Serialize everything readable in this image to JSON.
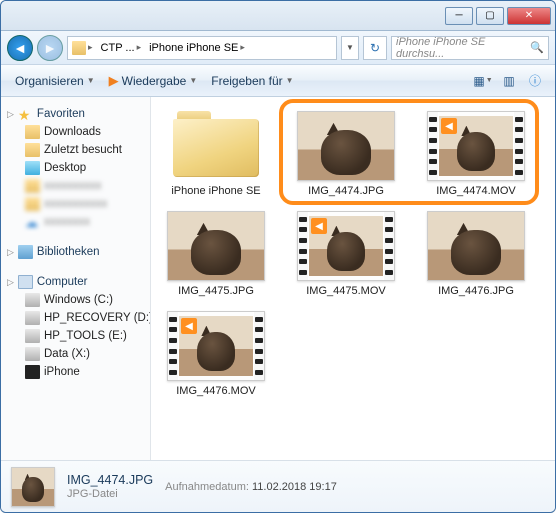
{
  "breadcrumb": {
    "seg1": "CTP ...",
    "seg2": "iPhone iPhone SE"
  },
  "search": {
    "placeholder": "iPhone iPhone SE durchsu..."
  },
  "toolbar": {
    "organize": "Organisieren",
    "playback": "Wiedergabe",
    "share": "Freigeben für"
  },
  "sidebar": {
    "favorites": "Favoriten",
    "downloads": "Downloads",
    "recent": "Zuletzt besucht",
    "desktop": "Desktop",
    "b1": "xxxxxxxxxx",
    "b2": "xxxxxxxxxxx",
    "b3": "xxxxxxxx",
    "libraries": "Bibliotheken",
    "computer": "Computer",
    "d1": "Windows (C:)",
    "d2": "HP_RECOVERY (D:)",
    "d3": "HP_TOOLS (E:)",
    "d4": "Data (X:)",
    "iphone": "iPhone"
  },
  "files": {
    "folder": "iPhone iPhone SE",
    "f1": "IMG_4474.JPG",
    "f2": "IMG_4474.MOV",
    "f3": "IMG_4475.JPG",
    "f4": "IMG_4475.MOV",
    "f5": "IMG_4476.JPG",
    "f6": "IMG_4476.MOV"
  },
  "details": {
    "name": "IMG_4474.JPG",
    "type": "JPG-Datei",
    "meta_label": "Aufnahmedatum:",
    "meta_value": "11.02.2018 19:17"
  }
}
